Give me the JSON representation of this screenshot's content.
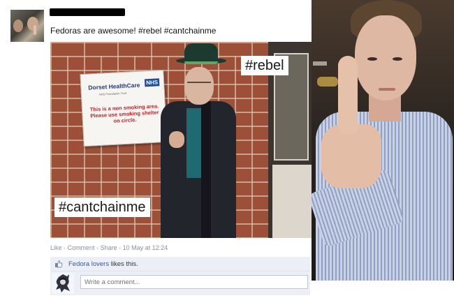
{
  "post": {
    "caption": "Fedoras are awesome! #rebel #cantchainme",
    "photo": {
      "sign": {
        "org": "Dorset HealthCare",
        "badge": "NHS",
        "subtitle": "NHS Foundation Trust",
        "message": "This is a non smoking area. Please use smoking shelter on circle."
      },
      "overlay_tags": [
        "#rebel",
        "#cantchainme"
      ]
    },
    "actions": {
      "like": "Like",
      "comment": "Comment",
      "share": "Share",
      "timestamp": "10 May at 12:24"
    },
    "likes": {
      "name": "Fedora lovers",
      "suffix": " likes this."
    },
    "comment_box": {
      "placeholder": "Write a comment..."
    }
  },
  "colors": {
    "link": "#3b5998",
    "meta": "#8a91a5",
    "panel": "#eceff5",
    "redaction": "#000000"
  },
  "icons": [
    "thumbs-up-icon",
    "profile-avatar",
    "commenter-avatar"
  ]
}
